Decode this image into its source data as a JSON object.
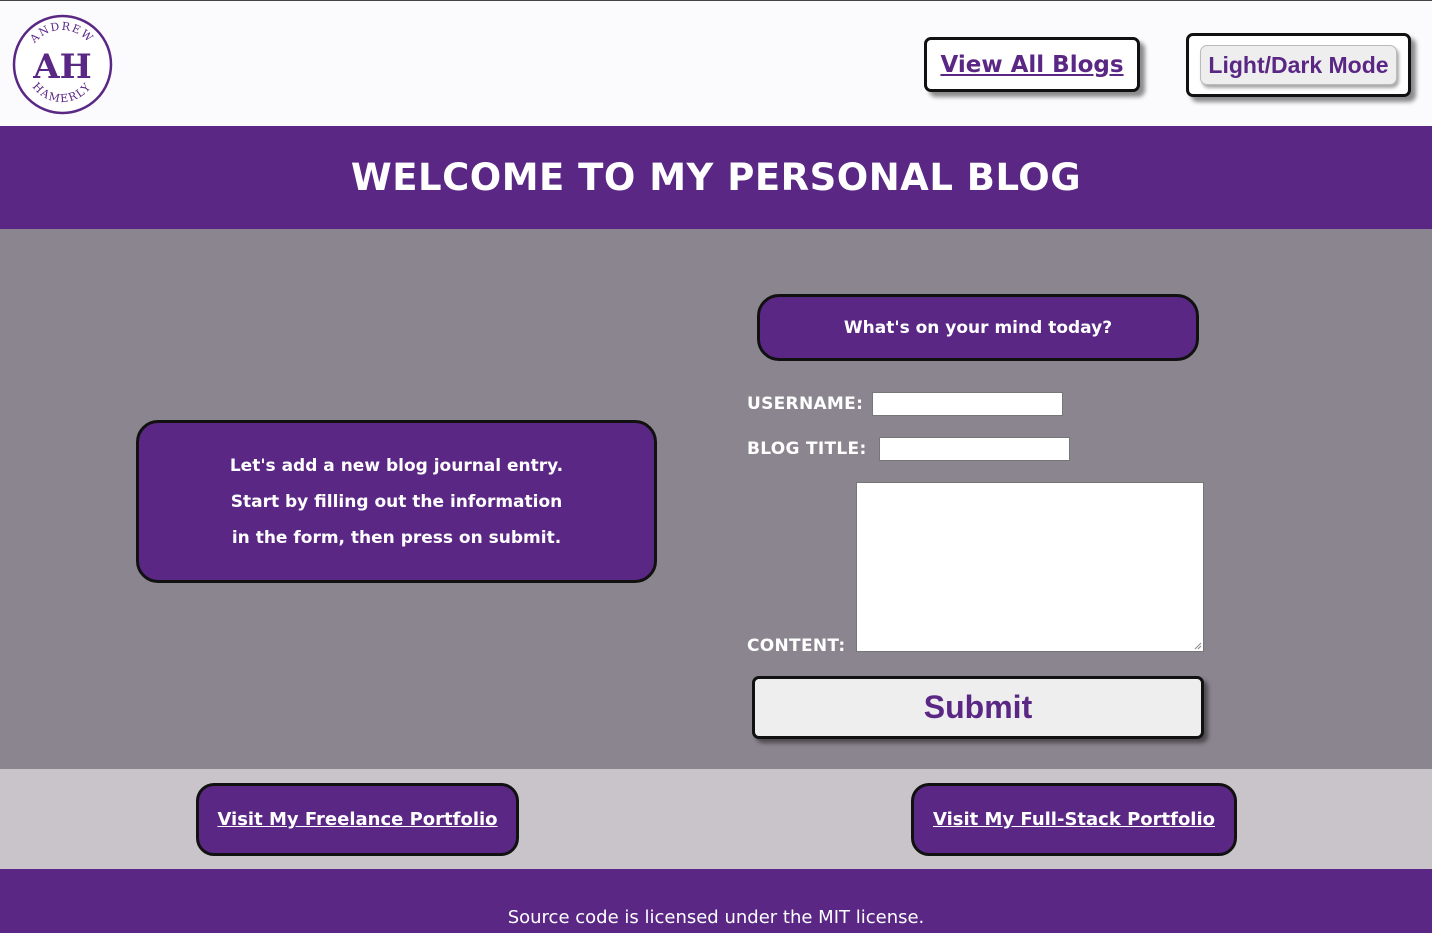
{
  "header": {
    "logo": {
      "initials": "AH",
      "top_text": "ANDREW",
      "bottom_text": "HAMERLY"
    },
    "view_all_blogs_label": "View All Blogs",
    "light_dark_label": "Light/Dark Mode"
  },
  "banner": {
    "title": "WELCOME TO MY PERSONAL BLOG"
  },
  "intro": {
    "lines": [
      "Let's add a new blog journal entry.",
      "Start by filling out the information",
      "in the form, then press on submit."
    ]
  },
  "form": {
    "prompt": "What's on your mind today?",
    "username_label": "USERNAME:",
    "username_value": "",
    "blog_title_label": "BLOG TITLE:",
    "blog_title_value": "",
    "content_label": "CONTENT:",
    "content_value": "",
    "submit_label": "Submit"
  },
  "links": {
    "freelance_label": "Visit My Freelance Portfolio",
    "fullstack_label": "Visit My Full-Stack Portfolio"
  },
  "footer": {
    "text": "Source code is licensed under the MIT license."
  },
  "colors": {
    "brand_purple": "#5a2785",
    "main_background": "#8b858f",
    "links_background": "#c8c4ca",
    "page_background": "#fbfbfe"
  },
  "icons": {
    "logo": "ah-monogram-logo",
    "textarea_grip": "resize-grip-icon"
  }
}
